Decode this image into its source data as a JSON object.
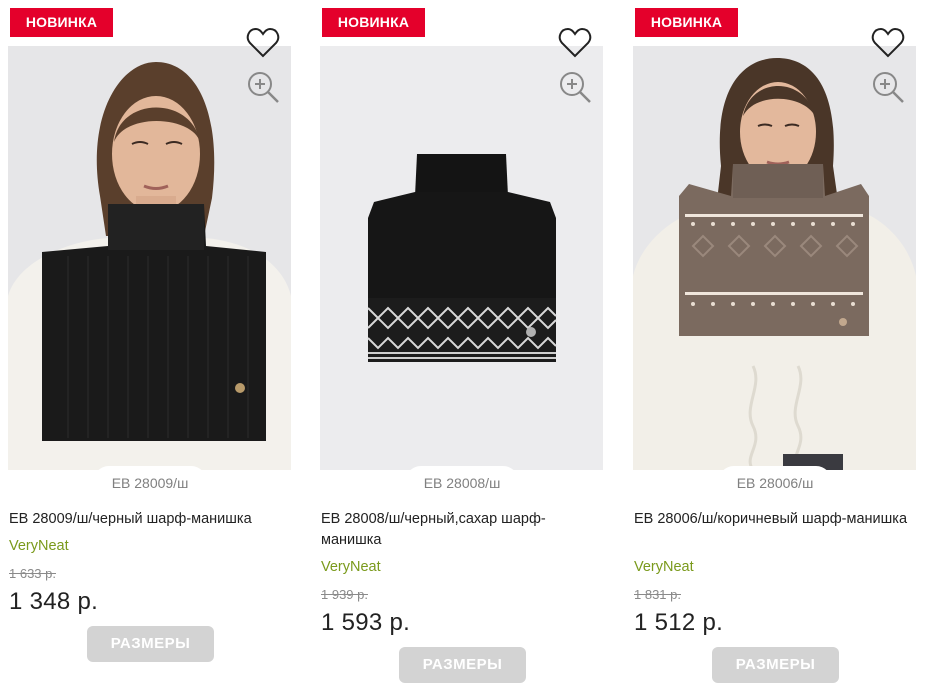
{
  "products": [
    {
      "badge": "НОВИНКА",
      "article": "EB 28009/ш",
      "title": "EB 28009/ш/черный шарф-манишка",
      "brand": "VeryNeat",
      "old_price": "1 633 р.",
      "price": "1 348 р.",
      "sizes_label": "РАЗМЕРЫ"
    },
    {
      "badge": "НОВИНКА",
      "article": "EB 28008/ш",
      "title": "EB 28008/ш/черный,сахар шарф-манишка",
      "brand": "VeryNeat",
      "old_price": "1 939 р.",
      "price": "1 593 р.",
      "sizes_label": "РАЗМЕРЫ"
    },
    {
      "badge": "НОВИНКА",
      "article": "EB 28006/ш",
      "title": "EB 28006/ш/коричневый шарф-манишка",
      "brand": "VeryNeat",
      "old_price": "1 831 р.",
      "price": "1 512 р.",
      "sizes_label": "РАЗМЕРЫ"
    }
  ],
  "icons": {
    "favorite": "heart-outline-icon",
    "zoom": "zoom-in-icon"
  },
  "colors": {
    "badge": "#e4002b",
    "brand": "#7a9a1c",
    "button": "#d3d3d3",
    "photo_bg": "#e9e9eb"
  }
}
